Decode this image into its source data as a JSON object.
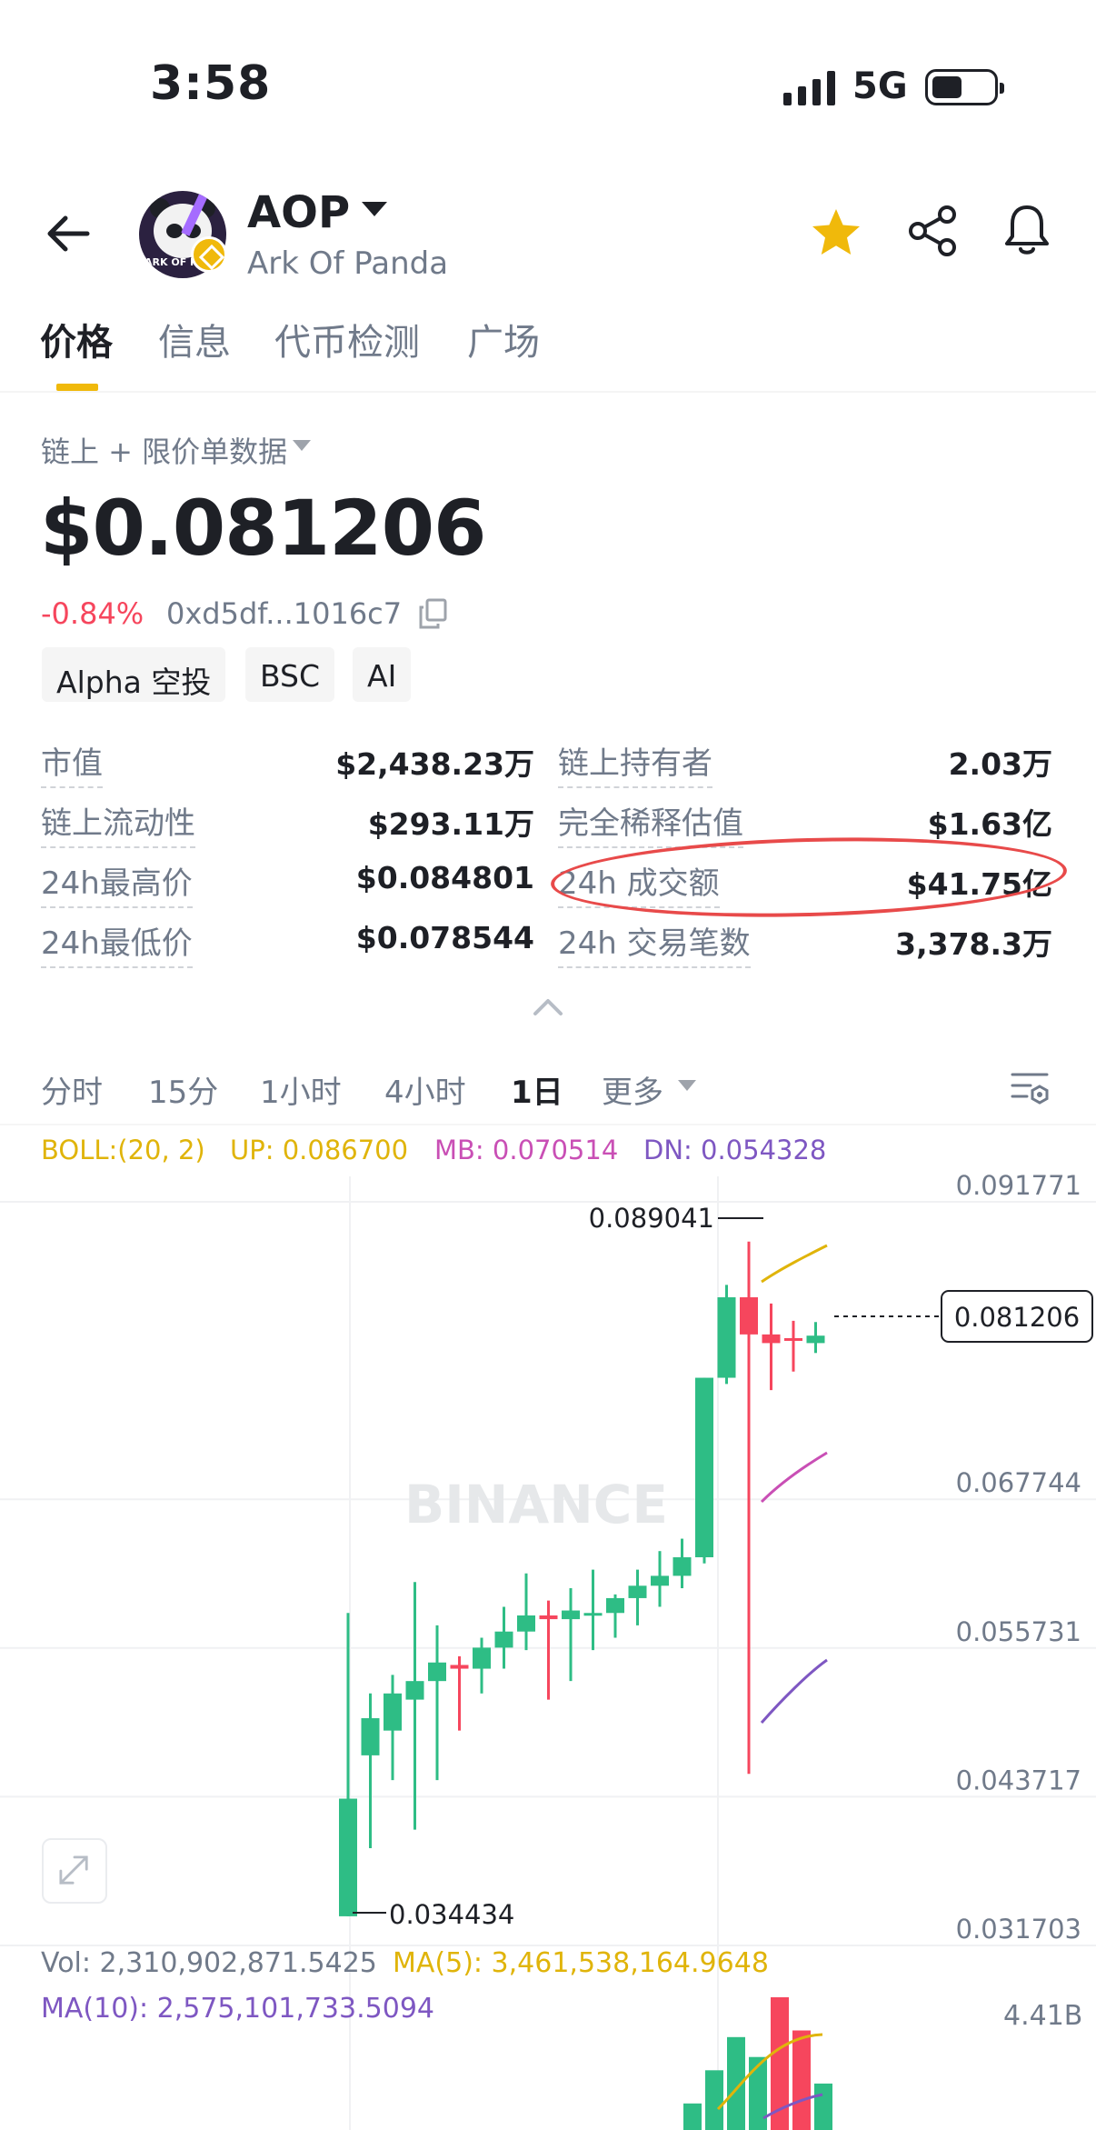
{
  "status_bar": {
    "time": "3:58",
    "network": "5G"
  },
  "header": {
    "symbol": "AOP",
    "name": "Ark Of Panda",
    "logo_text": "ARK OF P"
  },
  "tabs": [
    {
      "label": "价格",
      "active": true
    },
    {
      "label": "信息",
      "active": false
    },
    {
      "label": "代币检测",
      "active": false
    },
    {
      "label": "广场",
      "active": false
    }
  ],
  "data_source": "链上 + 限价单数据",
  "price": {
    "value": "$0.081206",
    "change": "-0.84%",
    "contract": "0xd5df...1016c7"
  },
  "tags": [
    "Alpha 空投",
    "BSC",
    "AI"
  ],
  "stats": [
    {
      "label": "市值",
      "value": "$2,438.23万"
    },
    {
      "label": "链上持有者",
      "value": "2.03万"
    },
    {
      "label": "链上流动性",
      "value": "$293.11万"
    },
    {
      "label": "完全稀释估值",
      "value": "$1.63亿"
    },
    {
      "label": "24h最高价",
      "value": "$0.084801"
    },
    {
      "label": "24h 成交额",
      "value": "$41.75亿"
    },
    {
      "label": "24h最低价",
      "value": "$0.078544"
    },
    {
      "label": "24h 交易笔数",
      "value": "3,378.3万"
    }
  ],
  "timeframes": [
    {
      "label": "分时",
      "active": false
    },
    {
      "label": "15分",
      "active": false
    },
    {
      "label": "1小时",
      "active": false
    },
    {
      "label": "4小时",
      "active": false
    },
    {
      "label": "1日",
      "active": true
    },
    {
      "label": "更多",
      "active": false
    }
  ],
  "boll": {
    "label": "BOLL:(20, 2)",
    "up": "UP: 0.086700",
    "mb": "MB: 0.070514",
    "dn": "DN: 0.054328"
  },
  "volume": {
    "vol": "Vol: 2,310,902,871.5425",
    "ma5": "MA(5): 3,461,538,164.9648",
    "ma10": "MA(10): 2,575,101,733.5094",
    "axis_label": "4.41B"
  },
  "colors": {
    "up": "#2ebd85",
    "down": "#f6465d",
    "accent": "#f0b90b",
    "boll_up": "#e0b40a",
    "boll_mb": "#c94fb5",
    "boll_dn": "#7e57c2"
  },
  "watermark": "BINANCE",
  "chart_data": {
    "type": "candlestick",
    "y_ticks": [
      "0.091771",
      "0.067744",
      "0.055731",
      "0.043717",
      "0.031703"
    ],
    "ylim": [
      0.031703,
      0.091771
    ],
    "current_price": "0.081206",
    "high_label": "0.089041",
    "low_label": "0.034434",
    "candles": [
      {
        "o": 0.044,
        "h": 0.059,
        "l": 0.0345,
        "c": 0.0345,
        "up": true
      },
      {
        "o": 0.0475,
        "h": 0.0525,
        "l": 0.04,
        "c": 0.0505,
        "up": true
      },
      {
        "o": 0.0495,
        "h": 0.054,
        "l": 0.0455,
        "c": 0.0525,
        "up": true
      },
      {
        "o": 0.052,
        "h": 0.0615,
        "l": 0.0415,
        "c": 0.0535,
        "up": true
      },
      {
        "o": 0.0535,
        "h": 0.058,
        "l": 0.0455,
        "c": 0.055,
        "up": true
      },
      {
        "o": 0.0548,
        "h": 0.0555,
        "l": 0.0495,
        "c": 0.0545,
        "down": true
      },
      {
        "o": 0.0545,
        "h": 0.057,
        "l": 0.0525,
        "c": 0.0562,
        "up": true
      },
      {
        "o": 0.0562,
        "h": 0.0595,
        "l": 0.0545,
        "c": 0.0575,
        "up": true
      },
      {
        "o": 0.0575,
        "h": 0.0622,
        "l": 0.056,
        "c": 0.0588,
        "up": true
      },
      {
        "o": 0.0588,
        "h": 0.06,
        "l": 0.052,
        "c": 0.0585,
        "down": true
      },
      {
        "o": 0.0585,
        "h": 0.061,
        "l": 0.0535,
        "c": 0.0592,
        "up": true
      },
      {
        "o": 0.059,
        "h": 0.0625,
        "l": 0.056,
        "c": 0.059,
        "up": true
      },
      {
        "o": 0.059,
        "h": 0.0605,
        "l": 0.057,
        "c": 0.0602,
        "up": true
      },
      {
        "o": 0.0602,
        "h": 0.0625,
        "l": 0.058,
        "c": 0.0612,
        "up": true
      },
      {
        "o": 0.0612,
        "h": 0.064,
        "l": 0.0595,
        "c": 0.062,
        "up": true
      },
      {
        "o": 0.062,
        "h": 0.065,
        "l": 0.061,
        "c": 0.0635,
        "up": true
      },
      {
        "o": 0.0635,
        "h": 0.078,
        "l": 0.063,
        "c": 0.078,
        "up": true
      },
      {
        "o": 0.078,
        "h": 0.0855,
        "l": 0.0775,
        "c": 0.0845,
        "up": true
      },
      {
        "o": 0.0845,
        "h": 0.089,
        "l": 0.046,
        "c": 0.0815,
        "down": true
      },
      {
        "o": 0.0808,
        "h": 0.084,
        "l": 0.077,
        "c": 0.0815,
        "down": true
      },
      {
        "o": 0.0812,
        "h": 0.0826,
        "l": 0.0785,
        "c": 0.0812,
        "down": true
      },
      {
        "o": 0.0808,
        "h": 0.0825,
        "l": 0.08,
        "c": 0.0814,
        "up": true
      }
    ],
    "volumes": [
      0.2,
      0.45,
      0.7,
      0.55,
      1.0,
      0.75,
      0.35
    ]
  }
}
